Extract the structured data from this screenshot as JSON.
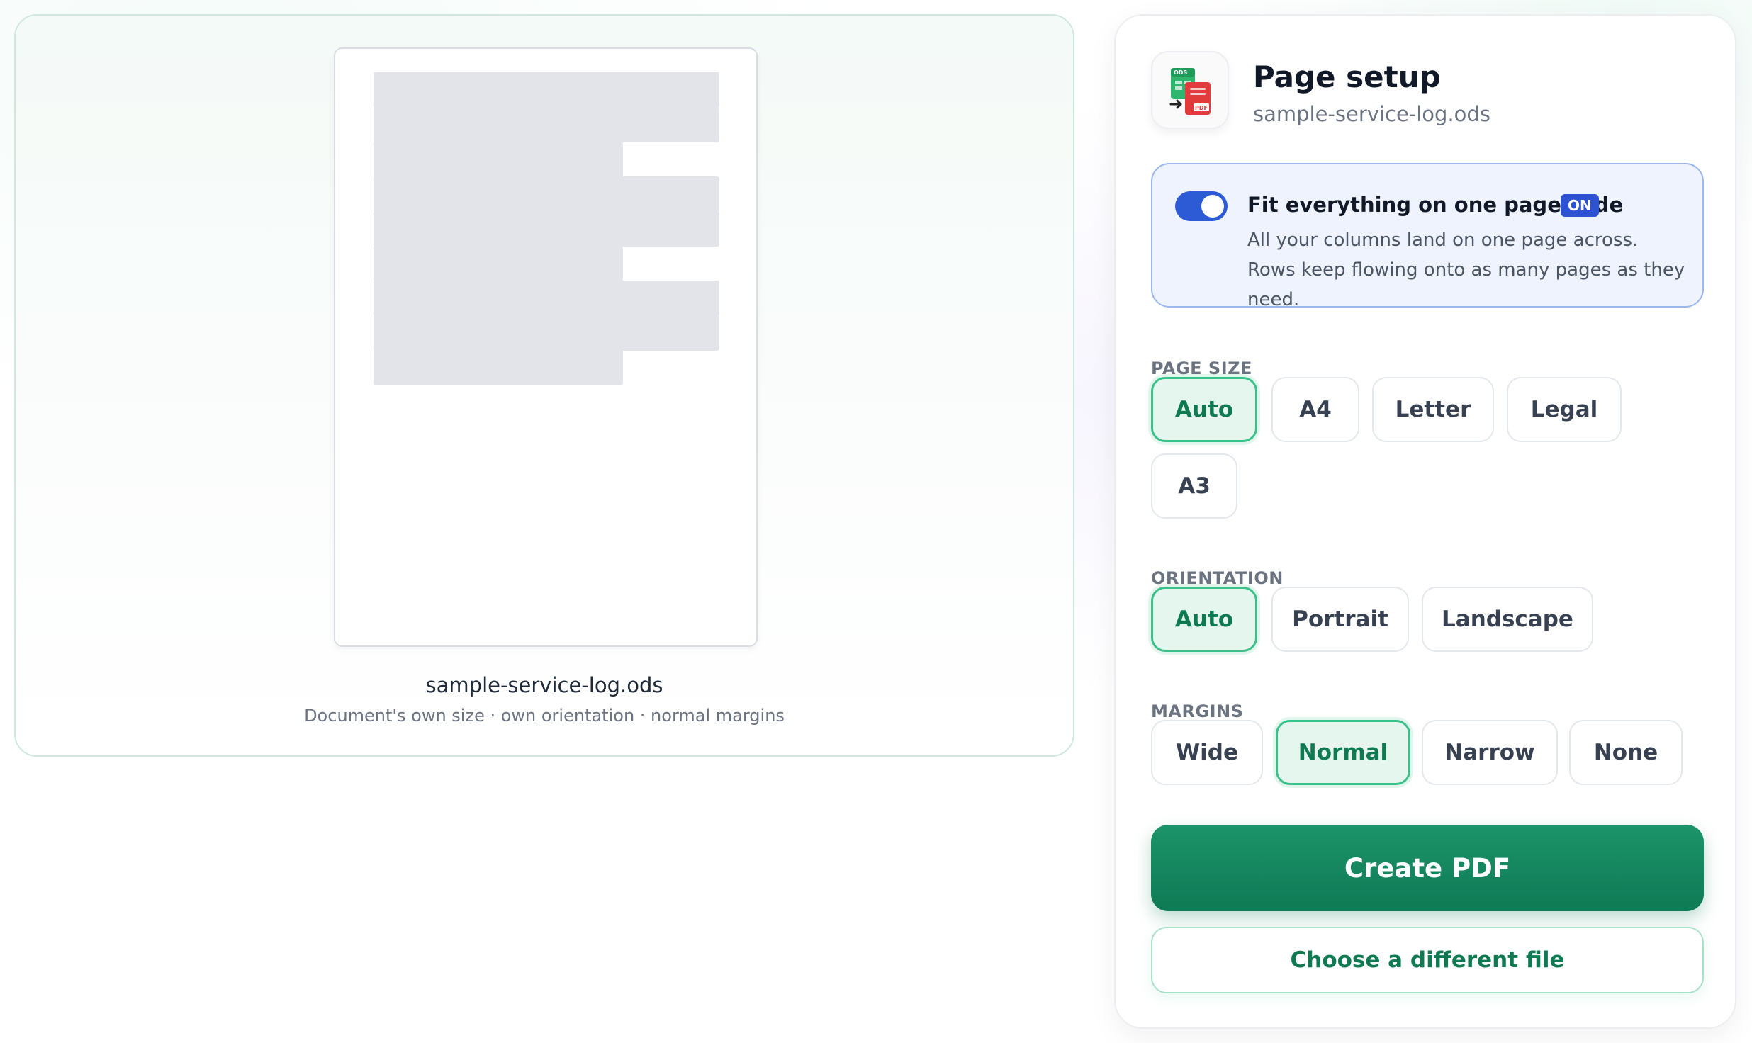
{
  "preview": {
    "file_name": "sample-service-log.ods",
    "summary": "Document's own size · own orientation · normal margins"
  },
  "panel": {
    "title": "Page setup",
    "file_name": "sample-service-log.ods",
    "icon_badges": {
      "source": "ODS",
      "target": "PDF"
    }
  },
  "fit_option": {
    "label": "Fit everything on one page wide",
    "state_badge": "ON",
    "enabled": true,
    "description": "All your columns land on one page across. Rows keep flowing onto as many pages as they need."
  },
  "page_size": {
    "label": "PAGE SIZE",
    "options": [
      "Auto",
      "A4",
      "Letter",
      "Legal",
      "A3"
    ],
    "selected": "Auto"
  },
  "orientation": {
    "label": "ORIENTATION",
    "options": [
      "Auto",
      "Portrait",
      "Landscape"
    ],
    "selected": "Auto"
  },
  "margins": {
    "label": "MARGINS",
    "options": [
      "Wide",
      "Normal",
      "Narrow",
      "None"
    ],
    "selected": "Normal"
  },
  "actions": {
    "create_label": "Create PDF",
    "choose_label": "Choose a different file"
  },
  "colors": {
    "primary_green": "#0f7a55",
    "selected_chip_bg": "#e4f6ee",
    "toggle_blue": "#2d5bd6",
    "fit_box_bg": "#eef3fd"
  }
}
